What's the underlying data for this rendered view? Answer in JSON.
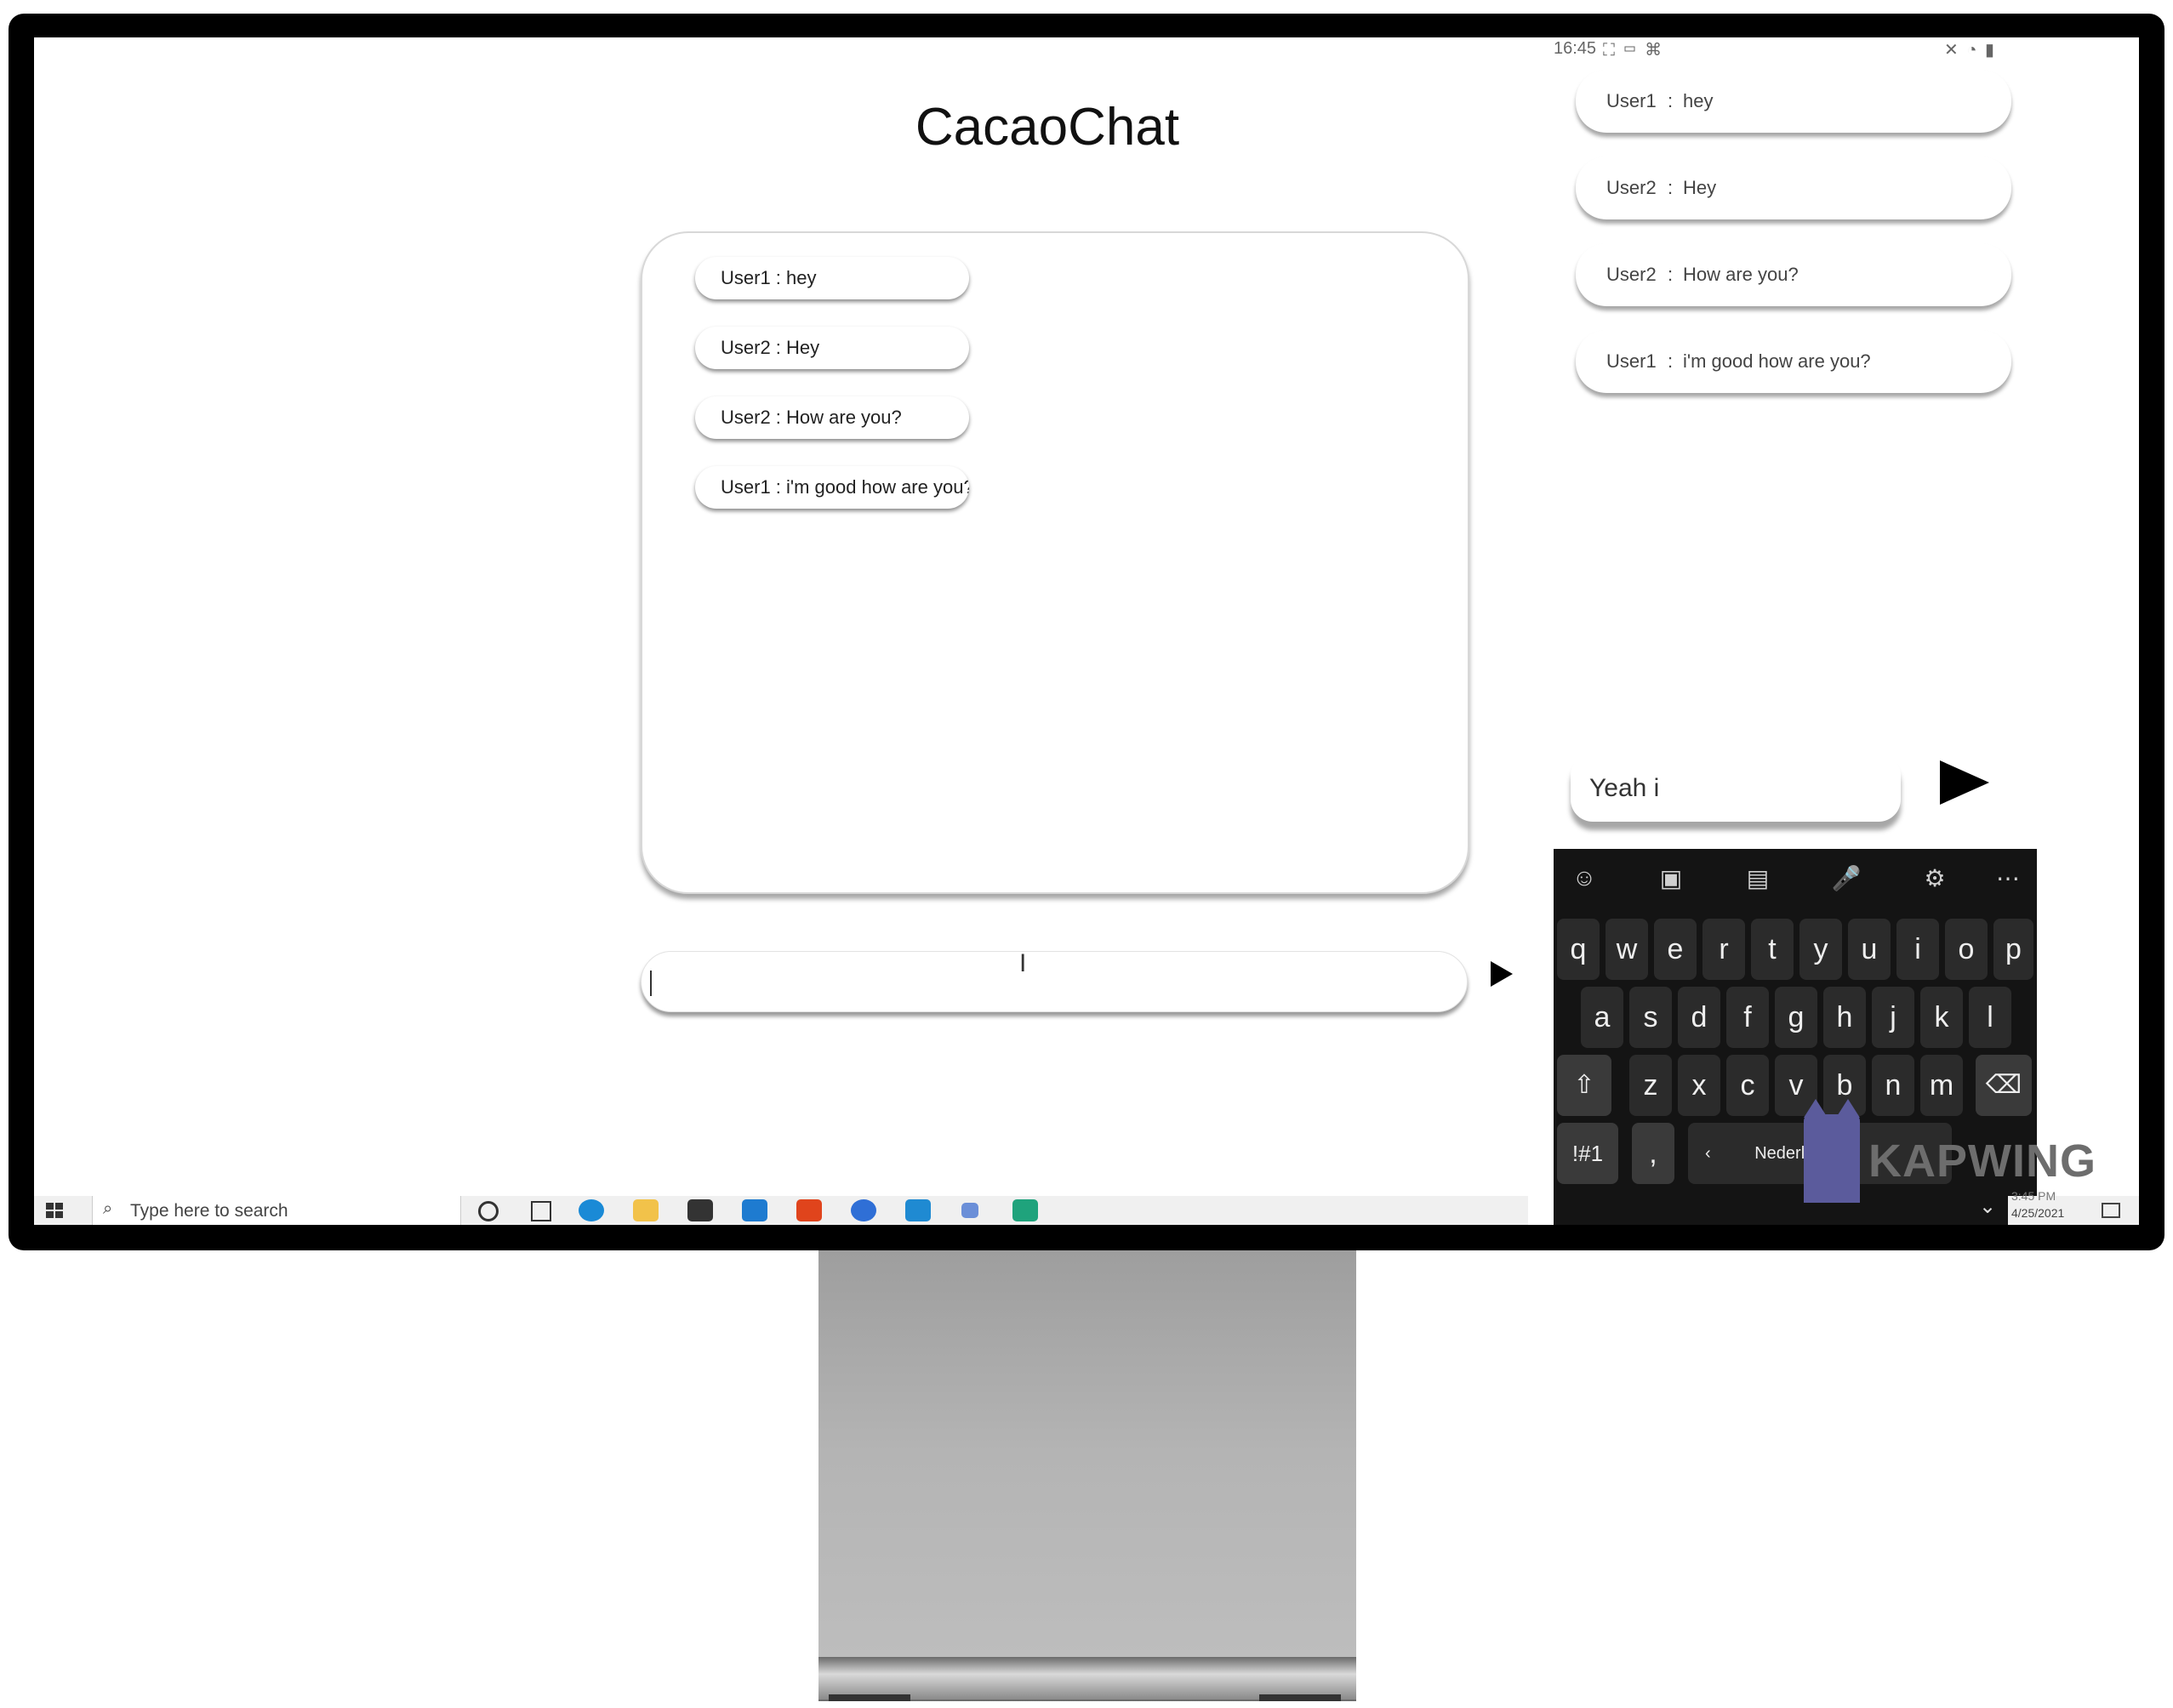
{
  "web": {
    "title": "CacaoChat",
    "messages": [
      {
        "text": "User1 : hey"
      },
      {
        "text": "User2 : Hey"
      },
      {
        "text": "User2 : How are you?"
      },
      {
        "text": "User1 : i'm good how are you?"
      }
    ],
    "input_value": ""
  },
  "phone": {
    "status": {
      "time": "16:45",
      "left_icons": "⛶ ▭ ⌘",
      "right_icons": "✕ ◔ ▮"
    },
    "messages": [
      {
        "user": "User1",
        "sep": ":",
        "text": "hey"
      },
      {
        "user": "User2",
        "sep": ":",
        "text": "Hey"
      },
      {
        "user": "User2",
        "sep": ":",
        "text": "How are you?"
      },
      {
        "user": "User1",
        "sep": ":",
        "text": "i'm good how are you?"
      }
    ],
    "input_value": "Yeah i"
  },
  "keyboard": {
    "toolbar": [
      "☺",
      "▣",
      "▤",
      "🎤",
      "⚙",
      "⋯"
    ],
    "row1": [
      "q",
      "w",
      "e",
      "r",
      "t",
      "y",
      "u",
      "i",
      "o",
      "p"
    ],
    "row2": [
      "a",
      "s",
      "d",
      "f",
      "g",
      "h",
      "j",
      "k",
      "l"
    ],
    "row3": [
      "⇧",
      "z",
      "x",
      "c",
      "v",
      "b",
      "n",
      "m",
      "⌫"
    ],
    "row4": [
      "!#1",
      ",",
      "‹",
      "Nederlands"
    ]
  },
  "taskbar": {
    "search_placeholder": "Type here to search",
    "tray_time": "3:45 PM",
    "tray_date": "4/25/2021"
  },
  "watermark": {
    "text": "KAPWING"
  },
  "colors": {
    "accent": "#000000",
    "keyboard_bg": "#141414",
    "taskbar_bg": "#f0f0f0"
  }
}
